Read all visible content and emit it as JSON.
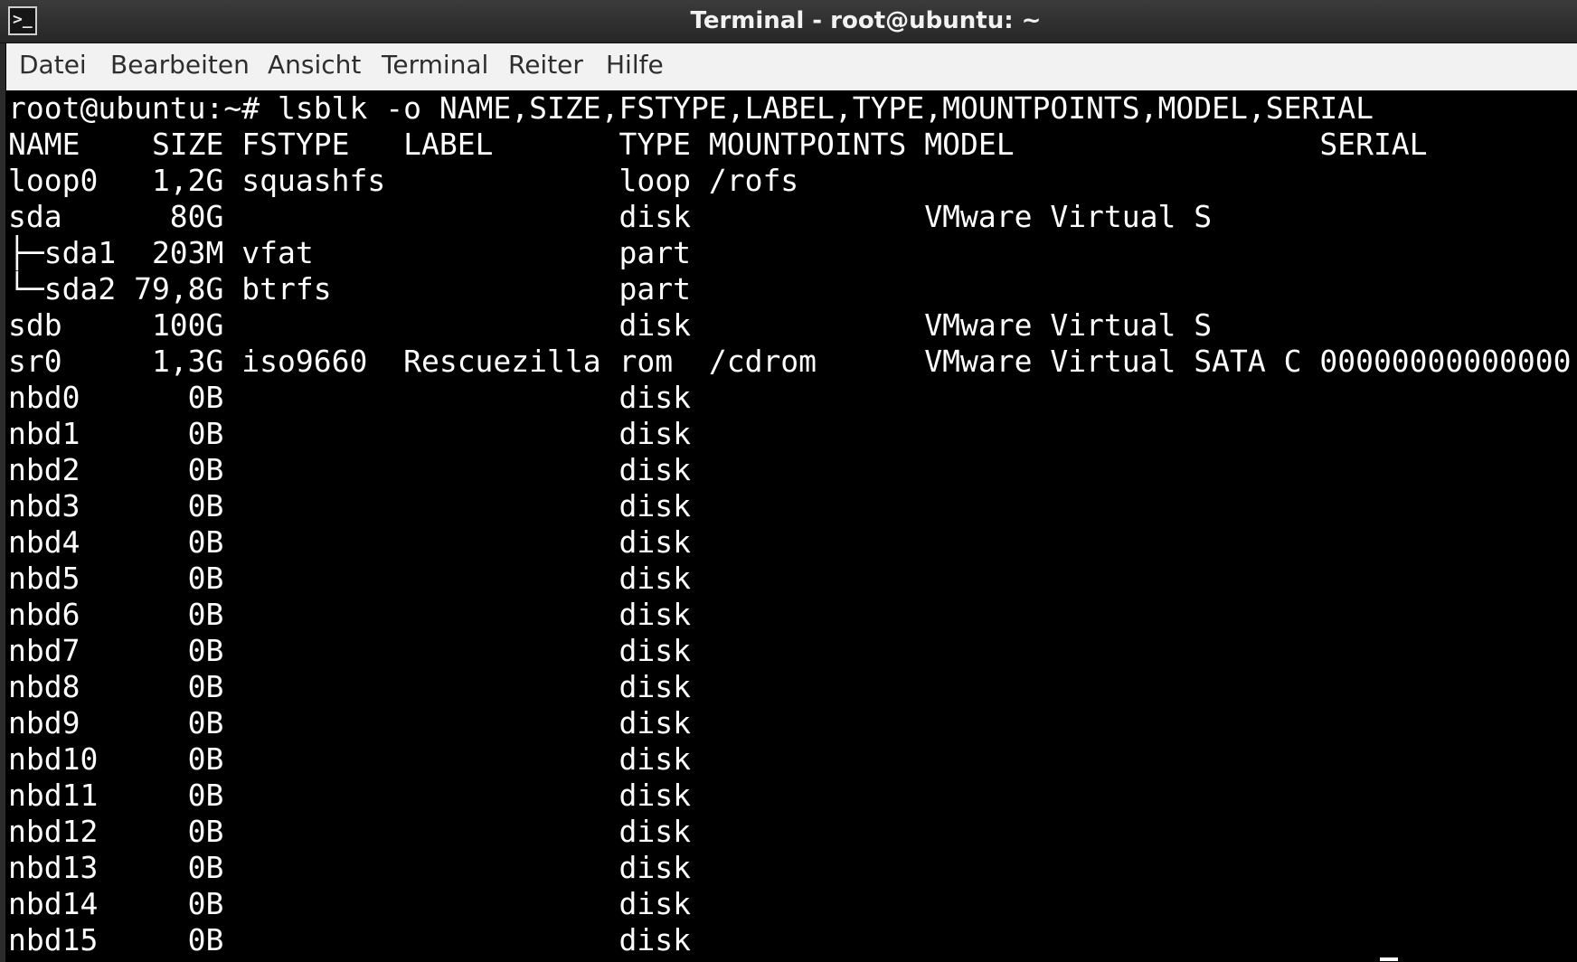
{
  "window": {
    "title": "Terminal - root@ubuntu: ~",
    "icon": "terminal-icon",
    "icon_glyph": ">_"
  },
  "menu": {
    "items": [
      "Datei",
      "Bearbeiten",
      "Ansicht",
      "Terminal",
      "Reiter",
      "Hilfe"
    ]
  },
  "terminal": {
    "prompt": "root@ubuntu:~# ",
    "command": "lsblk -o NAME,SIZE,FSTYPE,LABEL,TYPE,MOUNTPOINTS,MODEL,SERIAL",
    "output_lines": [
      "NAME    SIZE FSTYPE   LABEL       TYPE MOUNTPOINTS MODEL                 SERIAL",
      "loop0   1,2G squashfs             loop /rofs",
      "sda      80G                      disk             VMware Virtual S",
      "├─sda1  203M vfat                 part",
      "└─sda2 79,8G btrfs                part",
      "sdb     100G                      disk             VMware Virtual S",
      "sr0     1,3G iso9660  Rescuezilla rom  /cdrom      VMware Virtual SATA C 00000000000000",
      "nbd0      0B                      disk",
      "nbd1      0B                      disk",
      "nbd2      0B                      disk",
      "nbd3      0B                      disk",
      "nbd4      0B                      disk",
      "nbd5      0B                      disk",
      "nbd6      0B                      disk",
      "nbd7      0B                      disk",
      "nbd8      0B                      disk",
      "nbd9      0B                      disk",
      "nbd10     0B                      disk",
      "nbd11     0B                      disk",
      "nbd12     0B                      disk",
      "nbd13     0B                      disk",
      "nbd14     0B                      disk",
      "nbd15     0B                      disk"
    ]
  },
  "colors": {
    "terminal_background": "#000000",
    "terminal_foreground": "#ffffff",
    "menubar_background": "#f2f2f2",
    "titlebar_background": "#2f2f2f"
  }
}
